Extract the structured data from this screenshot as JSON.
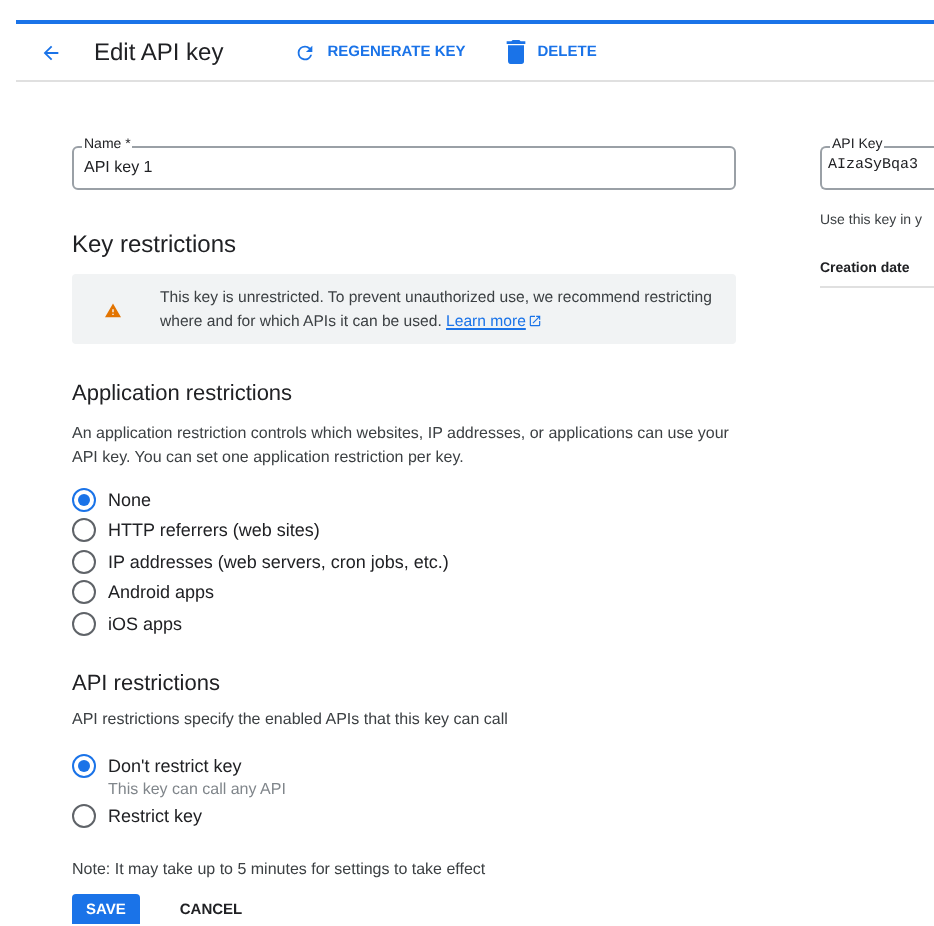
{
  "header": {
    "title": "Edit API key",
    "actions": [
      {
        "kind": "regenerate",
        "label": "REGENERATE KEY"
      },
      {
        "kind": "delete",
        "label": "DELETE"
      }
    ]
  },
  "name_field": {
    "label": "Name *",
    "value": "API key 1"
  },
  "key_restrictions": {
    "title": "Key restrictions",
    "warning": "This key is unrestricted. To prevent unauthorized use, we recommend restricting where and for which APIs it can be used.",
    "link": "Learn more"
  },
  "application_restrictions": {
    "title": "Application restrictions",
    "description": "An application restriction controls which websites, IP addresses, or applications can use your API key. You can set one application restriction per key.",
    "options": [
      {
        "label": "None",
        "selected": true
      },
      {
        "label": "HTTP referrers (web sites)",
        "selected": false
      },
      {
        "label": "IP addresses (web servers, cron jobs, etc.)",
        "selected": false
      },
      {
        "label": "Android apps",
        "selected": false
      },
      {
        "label": "iOS apps",
        "selected": false
      }
    ]
  },
  "api_restrictions": {
    "title": "API restrictions",
    "description": "API restrictions specify the enabled APIs that this key can call",
    "options": [
      {
        "label": "Don't restrict key",
        "hint": "This key can call any API",
        "selected": true
      },
      {
        "label": "Restrict key",
        "selected": false
      }
    ]
  },
  "note": "Note: It may take up to 5 minutes for settings to take effect",
  "buttons": [
    {
      "kind": "primary",
      "label": "SAVE"
    },
    {
      "kind": "text",
      "label": "CANCEL"
    }
  ],
  "side_panel": {
    "key_field": {
      "label": "API Key",
      "value": "AIzaSyBqa3"
    },
    "usage": "Use this key in y",
    "creation_label": "Creation date"
  }
}
